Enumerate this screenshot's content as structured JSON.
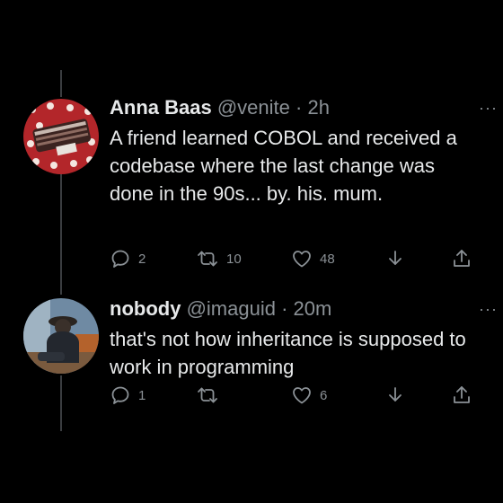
{
  "tweets": [
    {
      "name": "Anna Baas",
      "handle": "@venite",
      "separator": "·",
      "time": "2h",
      "text": "A friend learned COBOL and received a codebase where the last change was done in the 90s... by. his. mum.",
      "more": "···",
      "replies": "2",
      "retweets": "10",
      "likes": "48",
      "avatar_color": "#b3262a"
    },
    {
      "name": "nobody",
      "handle": "@imaguid",
      "separator": "·",
      "time": "20m",
      "text": "that's not how inheritance is supposed to work in programming",
      "more": "···",
      "replies": "1",
      "retweets": "",
      "likes": "6",
      "avatar_color": "#6f8aa3"
    }
  ],
  "icons": [
    "reply-icon",
    "retweet-icon",
    "like-icon",
    "download-icon",
    "share-icon"
  ],
  "colors": {
    "background": "#000000",
    "text": "#e7e9ea",
    "muted": "#8b9196",
    "thread_line": "#3a3d40"
  }
}
